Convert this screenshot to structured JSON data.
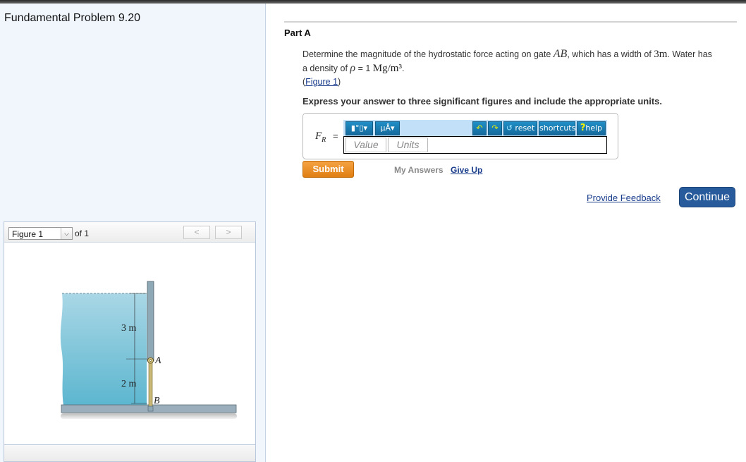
{
  "left_panel": {
    "title": "Fundamental Problem 9.20",
    "figure_nav": {
      "selected": "Figure 1",
      "of_label": "of 1",
      "prev_glyph": "<",
      "next_glyph": ">"
    },
    "figure": {
      "labels": {
        "dim_top": "3 m",
        "dim_bottom": "2 m",
        "point_a": "A",
        "point_b": "B"
      },
      "colors": {
        "water_top": "#a9d7e6",
        "water_bottom": "#5cb6cf",
        "wall": "#8fa8b6",
        "gate": "#c9b876",
        "ground": "#9aaebb"
      }
    }
  },
  "main": {
    "part_label": "Part A",
    "prompt": {
      "line1_pre": "Determine the magnitude of the hydrostatic force acting on gate ",
      "gate_symbol": "AB",
      "line1_mid": ", which has a width of ",
      "width_value": "3m",
      "line1_post": ". Water has",
      "line2_pre": "a density of ",
      "rho_symbol": "ρ",
      "line2_eq": " = 1 ",
      "density_units": "Mg/m³",
      "line2_post": "."
    },
    "figure_link": {
      "open": "(",
      "label": "Figure 1",
      "close": ")"
    },
    "instructions": "Express your answer to three significant figures and include the appropriate units.",
    "answer": {
      "variable": "F",
      "subscript": "R",
      "equals": "=",
      "toolbar": {
        "templates_label": "▮°▯▾",
        "symbols_label": "μÅ▾",
        "undo_glyph": "↶",
        "redo_glyph": "↷",
        "reset_glyph": "↺",
        "reset_label": "reset",
        "shortcuts_label": "shortcuts",
        "help_glyph": "?",
        "help_label": "help"
      },
      "value_placeholder": "Value",
      "units_placeholder": "Units"
    },
    "submit_label": "Submit",
    "my_answers_label": "My Answers",
    "give_up_label": "Give Up",
    "provide_feedback_label": "Provide Feedback",
    "continue_label": "Continue"
  },
  "colors": {
    "link": "#1a3d8c",
    "submit": "#e8891f",
    "continue": "#285b9b",
    "toolbar_bg": "#c2e0f7",
    "toolbar_button": "#1a7fb5"
  }
}
